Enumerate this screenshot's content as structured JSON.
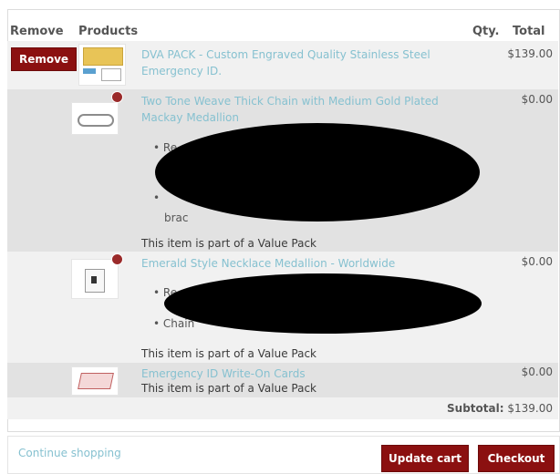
{
  "headers": {
    "remove": "Remove",
    "products": "Products",
    "qty": "Qty.",
    "total": "Total"
  },
  "items": [
    {
      "remove_label": "Remove",
      "title": "DVA PACK - Custom Engraved Quality Stainless Steel Emergency ID.",
      "price": "$139.00"
    },
    {
      "title": "Two Tone Weave Thick Chain with Medium Gold Plated Mackay Medallion",
      "price": "$0.00",
      "bullet_partials": [
        "Re",
        "brac"
      ],
      "note": "This item is part of a Value Pack"
    },
    {
      "title": "Emerald Style Necklace Medallion - Worldwide",
      "price": "$0.00",
      "bullet_partials": [
        "Re",
        "Chain"
      ],
      "note": "This item is part of a Value Pack"
    },
    {
      "title": "Emergency ID Write-On Cards",
      "price": "$0.00",
      "note": "This item is part of a Value Pack"
    }
  ],
  "subtotal": {
    "label": "Subtotal:",
    "value": "$139.00"
  },
  "footer": {
    "continue_label": "Continue shopping",
    "update_label": "Update cart",
    "checkout_label": "Checkout"
  },
  "colors": {
    "button": "#8b1010",
    "link": "#86c1d0",
    "row_light": "#f1f1f1",
    "row_dark": "#e2e2e2"
  }
}
